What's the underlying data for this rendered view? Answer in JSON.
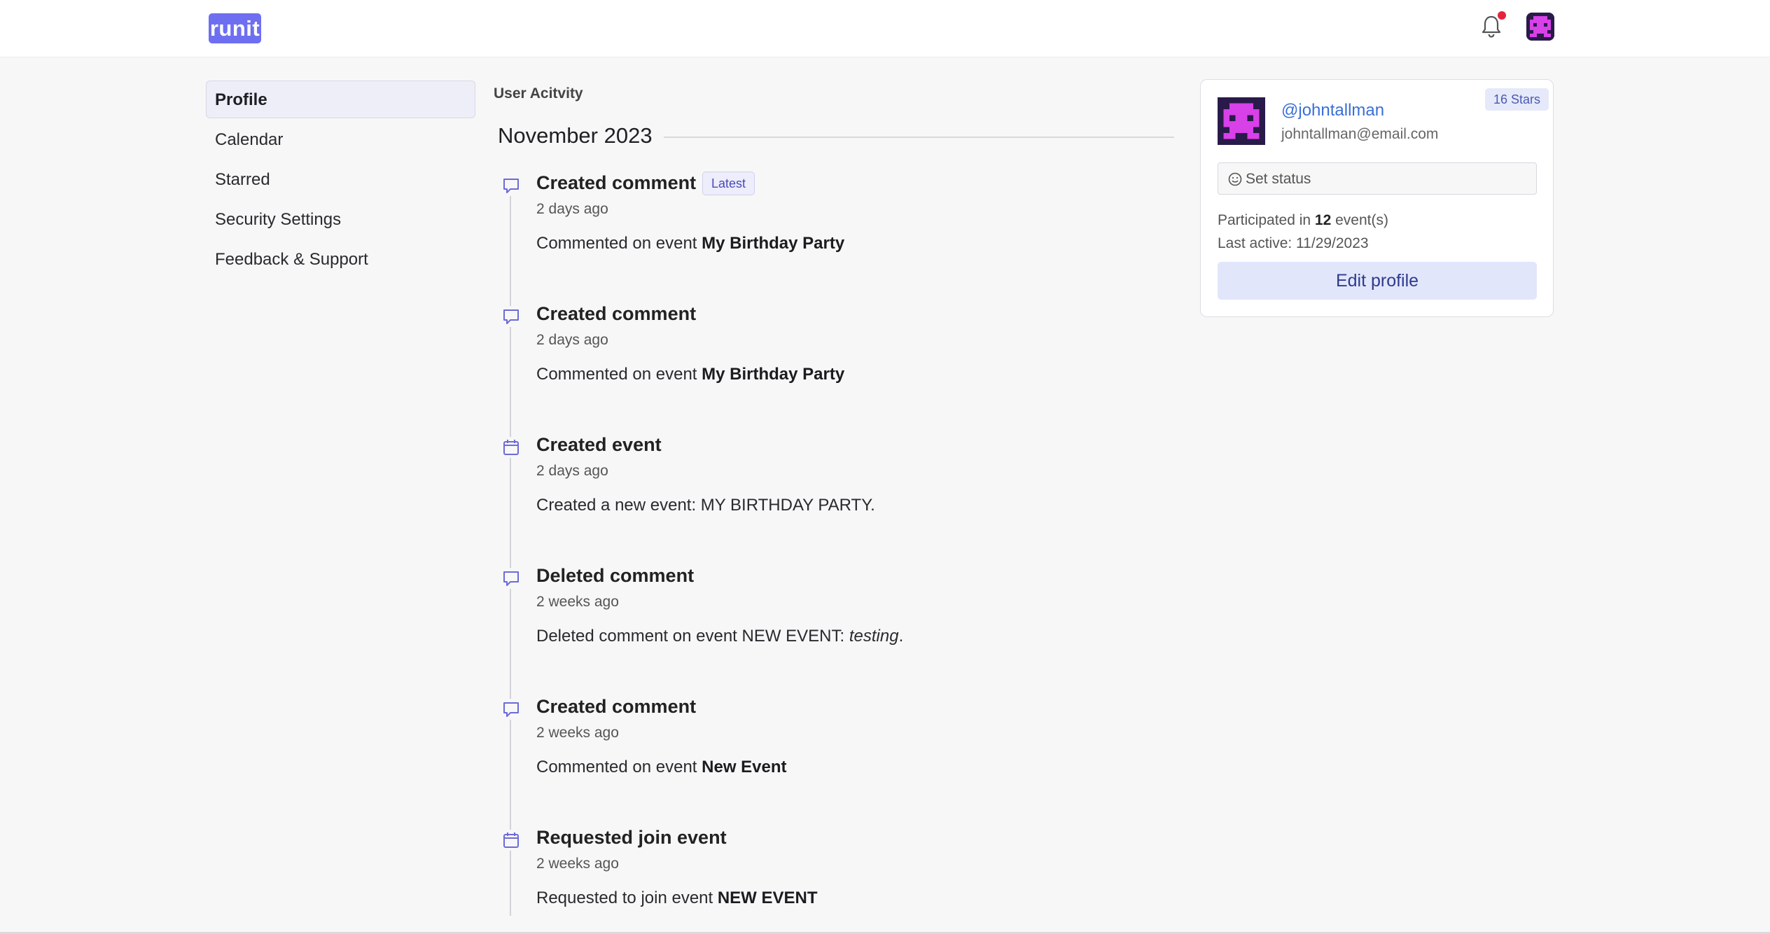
{
  "header": {
    "logo_text": "runit",
    "notification_icon": "bell-icon",
    "has_unread": true
  },
  "sidebar": {
    "items": [
      {
        "label": "Profile",
        "active": true
      },
      {
        "label": "Calendar",
        "active": false
      },
      {
        "label": "Starred",
        "active": false
      },
      {
        "label": "Security Settings",
        "active": false
      },
      {
        "label": "Feedback & Support",
        "active": false
      }
    ]
  },
  "activity": {
    "section_label": "User Acitvity",
    "month": "November 2023",
    "latest_badge": "Latest",
    "entries": [
      {
        "icon": "comment-icon",
        "title": "Created comment",
        "time": "2 days ago",
        "desc_prefix": "Commented on event ",
        "desc_bold": "My Birthday Party",
        "desc_suffix": ""
      },
      {
        "icon": "comment-icon",
        "title": "Created comment",
        "time": "2 days ago",
        "desc_prefix": "Commented on event ",
        "desc_bold": "My Birthday Party",
        "desc_suffix": ""
      },
      {
        "icon": "calendar-icon",
        "title": "Created event",
        "time": "2 days ago",
        "desc_prefix": "Created a new event: MY BIRTHDAY PARTY.",
        "desc_bold": "",
        "desc_suffix": ""
      },
      {
        "icon": "comment-icon",
        "title": "Deleted comment",
        "time": "2 weeks ago",
        "desc_prefix": "Deleted comment on event NEW EVENT: ",
        "desc_italic": "testing",
        "desc_suffix": "."
      },
      {
        "icon": "comment-icon",
        "title": "Created comment",
        "time": "2 weeks ago",
        "desc_prefix": "Commented on event ",
        "desc_bold": "New Event",
        "desc_suffix": ""
      },
      {
        "icon": "calendar-icon",
        "title": "Requested join event",
        "time": "2 weeks ago",
        "desc_prefix": "Requested to join event ",
        "desc_bold": "NEW EVENT",
        "desc_suffix": ""
      }
    ]
  },
  "profile_card": {
    "username": "@johntallman",
    "email": "johntallman@email.com",
    "stars_badge": "16 Stars",
    "status_placeholder": "Set status",
    "participated_prefix": "Participated in ",
    "participated_count": "12",
    "participated_suffix": " event(s)",
    "last_active": "Last active: 11/29/2023",
    "edit_button": "Edit profile"
  },
  "colors": {
    "brand": "#6e6ff0",
    "icon": "#6d6ad8",
    "notification_dot": "#e5243b",
    "avatar_fg": "#d840e8",
    "avatar_bg": "#2a1a4a"
  }
}
